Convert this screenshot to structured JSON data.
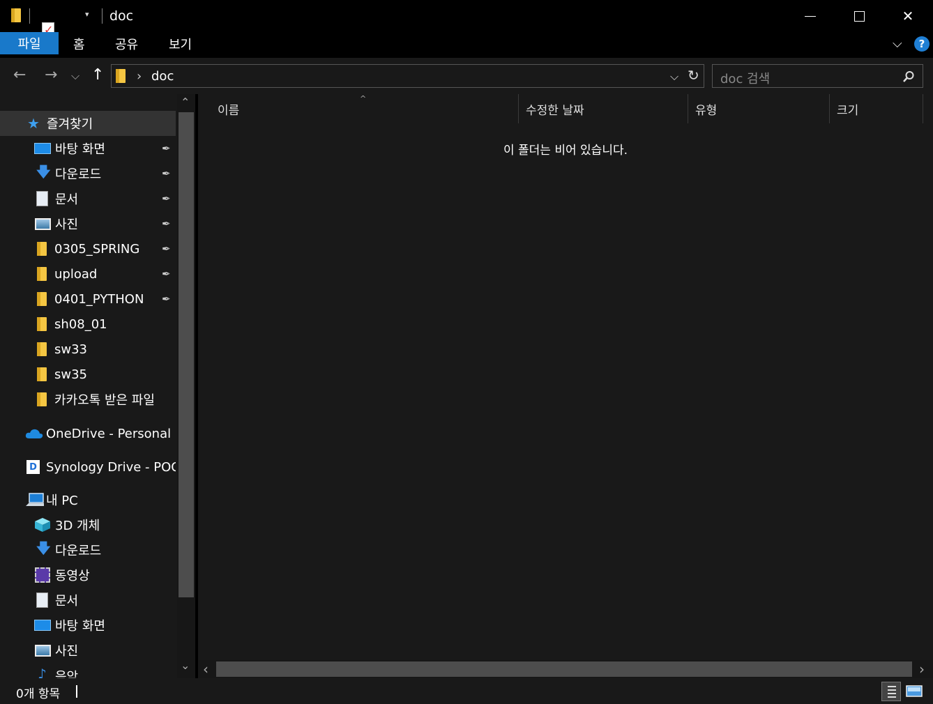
{
  "titlebar": {
    "title": "doc",
    "quick_access_caret": "▾",
    "minimize_label": "",
    "maximize_label": "",
    "close_label": "✕"
  },
  "ribbon": {
    "tabs": [
      "파일",
      "홈",
      "공유",
      "보기"
    ],
    "expand_caret": "⌵",
    "help": "?"
  },
  "nav": {
    "back": "←",
    "forward": "→",
    "recent": "⌵",
    "up": "↑"
  },
  "address": {
    "separator": "›",
    "path": "doc",
    "dropdown": "⌵",
    "refresh": "↻"
  },
  "search": {
    "placeholder": "doc 검색"
  },
  "sidebar": {
    "quick_access": "즐겨찾기",
    "quick_items": [
      {
        "label": "바탕 화면",
        "icon": "desktop-icon",
        "pinned": true
      },
      {
        "label": "다운로드",
        "icon": "download-icon",
        "pinned": true
      },
      {
        "label": "문서",
        "icon": "document-icon",
        "pinned": true
      },
      {
        "label": "사진",
        "icon": "picture-icon",
        "pinned": true
      },
      {
        "label": "0305_SPRING",
        "icon": "folder-icon",
        "pinned": true
      },
      {
        "label": "upload",
        "icon": "folder-icon",
        "pinned": true
      },
      {
        "label": "0401_PYTHON",
        "icon": "folder-icon",
        "pinned": true
      },
      {
        "label": "sh08_01",
        "icon": "folder-icon",
        "pinned": false
      },
      {
        "label": "sw33",
        "icon": "folder-icon",
        "pinned": false
      },
      {
        "label": "sw35",
        "icon": "folder-icon",
        "pinned": false
      },
      {
        "label": "카카오톡 받은 파일",
        "icon": "folder-icon",
        "pinned": false
      }
    ],
    "onedrive": "OneDrive - Personal",
    "synology": "Synology Drive - POOF",
    "this_pc": "내 PC",
    "pc_items": [
      {
        "label": "3D 개체",
        "icon": "3d-objects-icon"
      },
      {
        "label": "다운로드",
        "icon": "download-icon"
      },
      {
        "label": "동영상",
        "icon": "video-icon"
      },
      {
        "label": "문서",
        "icon": "document-icon"
      },
      {
        "label": "바탕 화면",
        "icon": "desktop-icon"
      },
      {
        "label": "사진",
        "icon": "picture-icon"
      },
      {
        "label": "음악",
        "icon": "music-icon"
      }
    ],
    "pin_glyph": "📌"
  },
  "columns": {
    "name": "이름",
    "modified": "수정한 날짜",
    "type": "유형",
    "size": "크기",
    "sort_caret": "^"
  },
  "empty_message": "이 폴더는 비어 있습니다.",
  "status": {
    "item_count": "0개 항목"
  },
  "scroll": {
    "up": "⌃",
    "down": "⌄",
    "left": "‹",
    "right": "›"
  },
  "colors": {
    "accent": "#1979ca",
    "folder": "#f5c642",
    "background": "#191919"
  }
}
